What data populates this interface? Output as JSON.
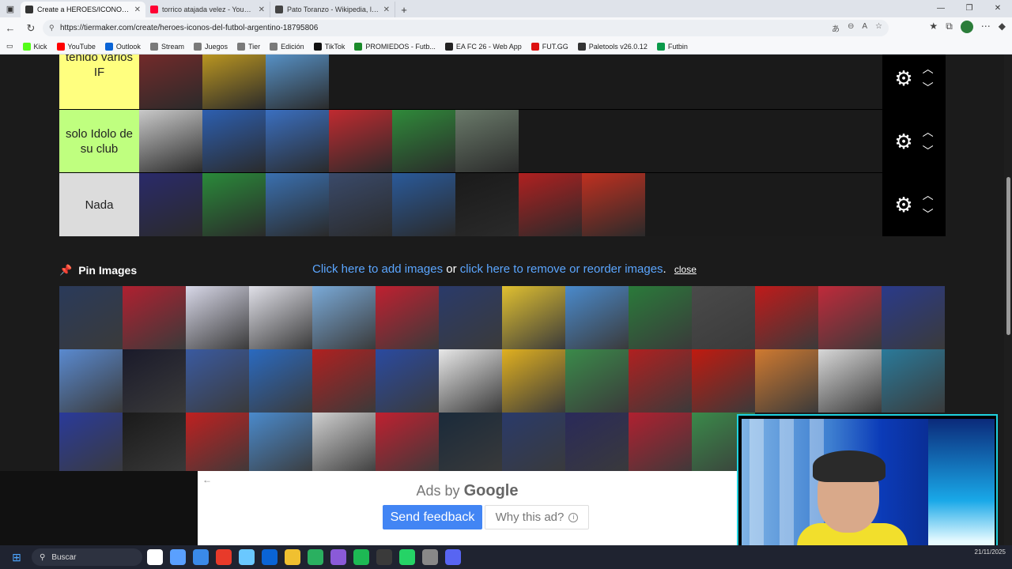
{
  "browser": {
    "tabs": [
      {
        "title": "Create a HEROES/ICONOS del FUTBOL...",
        "active": true,
        "color": "#333333"
      },
      {
        "title": "torrico atajada velez - YouTube",
        "active": false,
        "color": "#ff0033"
      },
      {
        "title": "Pato Toranzo - Wikipedia, la encic...",
        "active": false,
        "color": "#444444"
      }
    ],
    "url": "https://tiermaker.com/create/heroes-iconos-del-futbol-argentino-18795806",
    "bookmarks": [
      {
        "label": "Kick",
        "color": "#53fc18"
      },
      {
        "label": "YouTube",
        "color": "#ff0000"
      },
      {
        "label": "Outlook",
        "color": "#0a64d6"
      },
      {
        "label": "Stream",
        "color": "#7a7a7a"
      },
      {
        "label": "Juegos",
        "color": "#7a7a7a"
      },
      {
        "label": "Tier",
        "color": "#7a7a7a"
      },
      {
        "label": "Edición",
        "color": "#7a7a7a"
      },
      {
        "label": "TikTok",
        "color": "#111111"
      },
      {
        "label": "PROMIEDOS - Futb...",
        "color": "#1a8a2a"
      },
      {
        "label": "EA FC 26 - Web App",
        "color": "#222222"
      },
      {
        "label": "FUT.GG",
        "color": "#d11"
      },
      {
        "label": "Paletools v26.0.12",
        "color": "#333333"
      },
      {
        "label": "Futbin",
        "color": "#0a9a4a"
      }
    ]
  },
  "tiers": [
    {
      "label": "tenido varios IF",
      "color": "#ffff7f",
      "count": 3,
      "images": [
        "#7a2a2a",
        "#c8a020",
        "#5b9bd5"
      ]
    },
    {
      "label": "solo Idolo de su club",
      "color": "#bfff7f",
      "count": 6,
      "images": [
        "#c9c9c9",
        "#2d5fb0",
        "#3a6fc0",
        "#c02a30",
        "#2f8a3a",
        "#6a7a6a"
      ]
    },
    {
      "label": "Nada",
      "color": "#dcdcdc",
      "count": 8,
      "images": [
        "#2a2a6a",
        "#2a8a3a",
        "#3a70b0",
        "#3a4a6a",
        "#2a5a9a",
        "#1a1a1a",
        "#b02020",
        "#c03020"
      ]
    }
  ],
  "pin": {
    "title": "Pin Images",
    "add_link": "Click here to add images",
    "or_text": " or ",
    "remove_link": "click here to remove or reorder images",
    "period": ".",
    "close": "close"
  },
  "pool_images": [
    "#2a3a5a",
    "#b02030",
    "#d8d8e8",
    "#e0e0e8",
    "#7aaad8",
    "#c02030",
    "#2a3a6a",
    "#e0c030",
    "#4a8acc",
    "#2a7a3a",
    "#4a4a4a",
    "#c01a1a",
    "#c02a3a",
    "#2a3a8a",
    "#5a8ad0",
    "#1a1a2a",
    "#3a5aa0",
    "#2a6ac0",
    "#b02020",
    "#2a4aa0",
    "#e8e8e8",
    "#e0b020",
    "#3a8a4a",
    "#b02020",
    "#c01a10",
    "#d07a30",
    "#d8d8d8",
    "#2a7a9a",
    "#2a3a9a",
    "#1a1a1a",
    "#c02020",
    "#4a8acc",
    "#d0d0d0",
    "#c02030",
    "#1a2a3a",
    "#2a3a6a",
    "#2a2a5a",
    "#b02030",
    "#3a8a4a"
  ],
  "ad": {
    "ads_by": "Ads by",
    "google": "Google",
    "send_feedback": "Send feedback",
    "why": "Why this ad?"
  },
  "taskbar": {
    "search_label": "Buscar",
    "date": "21/11/2025",
    "apps": [
      "#ffffff",
      "#5aa0ff",
      "#3a8ae8",
      "#e83a2a",
      "#6ac8ff",
      "#0a64d6",
      "#f0c030",
      "#2ab060",
      "#8a5ad8",
      "#1db954",
      "#3a3a3a",
      "#25d366",
      "#888888",
      "#5865f2"
    ]
  }
}
